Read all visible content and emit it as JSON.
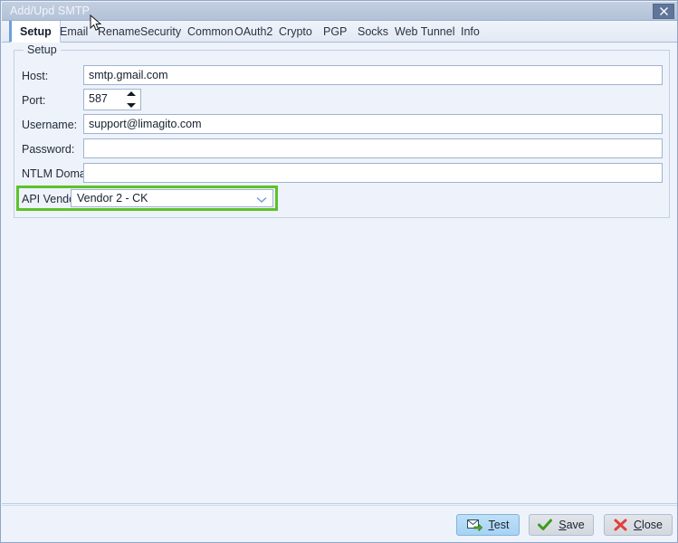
{
  "window": {
    "title": "Add/Upd SMTP",
    "close_icon": "close-icon"
  },
  "tabs": [
    {
      "label": "Setup",
      "active": true
    },
    {
      "label": "Email",
      "active": false
    },
    {
      "label": "Rename",
      "active": false
    },
    {
      "label": "Security",
      "active": false
    },
    {
      "label": "Common",
      "active": false
    },
    {
      "label": "OAuth2",
      "active": false
    },
    {
      "label": "Crypto",
      "active": false
    },
    {
      "label": "PGP",
      "active": false
    },
    {
      "label": "Socks",
      "active": false
    },
    {
      "label": "Web Tunnel",
      "active": false
    },
    {
      "label": "Info",
      "active": false
    }
  ],
  "setup": {
    "group_title": "Setup",
    "host": {
      "label": "Host:",
      "value": "smtp.gmail.com",
      "placeholder": ""
    },
    "port": {
      "label": "Port:",
      "value": "587"
    },
    "username": {
      "label": "Username:",
      "value": "support@limagito.com",
      "placeholder": ""
    },
    "password": {
      "label": "Password:",
      "value": "",
      "placeholder": ""
    },
    "ntlm_domain": {
      "label": "NTLM Domain",
      "value": "",
      "placeholder": ""
    },
    "api_vendor": {
      "label": "API Vendor",
      "value": "Vendor 2 - CK",
      "highlight_color": "#5cc22a",
      "arrow_icon": "chevron-down-icon"
    }
  },
  "buttons": {
    "test": {
      "label": "Test",
      "accel": "T",
      "icon": "mail-send-icon"
    },
    "save": {
      "label": "Save",
      "accel": "S",
      "icon": "check-icon"
    },
    "close": {
      "label": "Close",
      "accel": "C",
      "icon": "cross-icon"
    }
  },
  "colors": {
    "titlebar": "#b3c2d8",
    "accent_tab": "#6f9fd8",
    "highlight_green": "#5cc22a",
    "primary_button": "#a6d3f3"
  }
}
